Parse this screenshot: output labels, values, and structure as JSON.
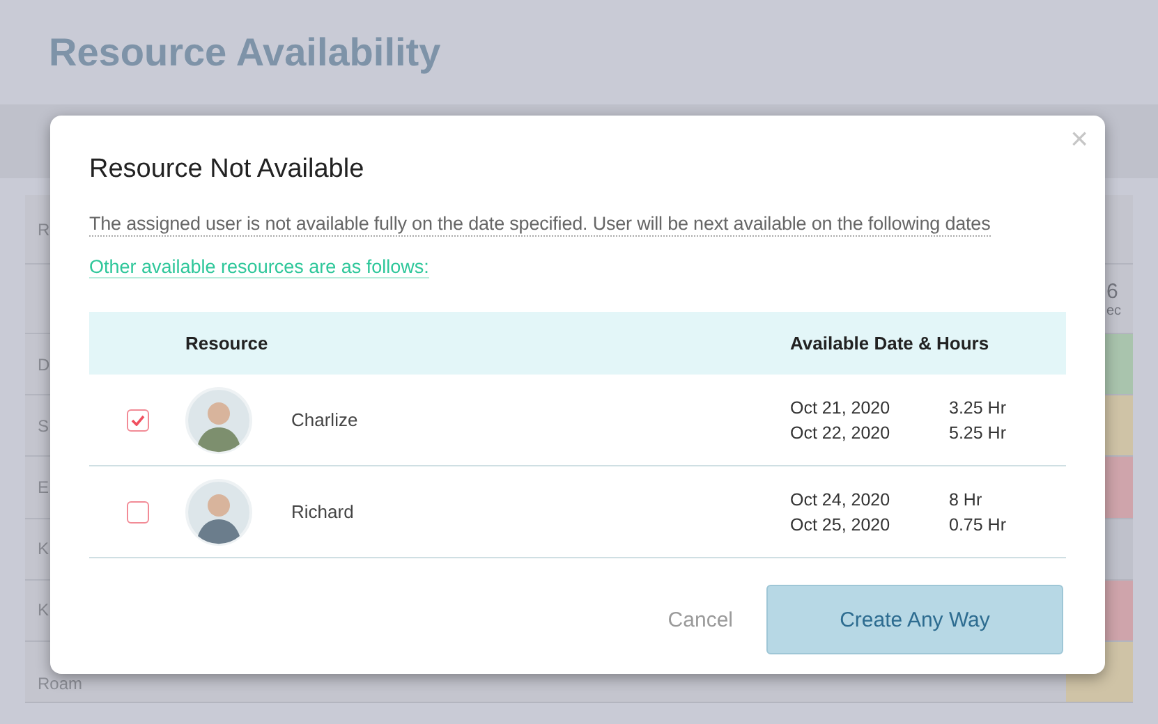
{
  "page": {
    "title": "Resource Availability"
  },
  "grid": {
    "header_label": "R",
    "header_date": "6",
    "header_month": "ec",
    "rows": [
      {
        "label": "D",
        "color": "#a9c4ad"
      },
      {
        "label": "S",
        "color": "#cfc3a6"
      },
      {
        "label": "E",
        "color": "#cfa4ab"
      },
      {
        "label": "K",
        "color": "#bfc1cb"
      },
      {
        "label": "K",
        "color": "#cfa4ab"
      },
      {
        "label": "Roam",
        "color": "#cfc3a6"
      }
    ]
  },
  "dialog": {
    "title": "Resource Not Available",
    "close": "×",
    "message": "The assigned user is not available fully on the date specified. User will be next available on the following dates",
    "link": "Other available resources are as follows:",
    "columns": [
      "Resource",
      "Available Date & Hours"
    ],
    "rows": [
      {
        "name": "Charlize",
        "checked": true,
        "slots": [
          {
            "date": "Oct 21, 2020",
            "hours": "3.25 Hr"
          },
          {
            "date": "Oct 22, 2020",
            "hours": "5.25 Hr"
          }
        ]
      },
      {
        "name": "Richard",
        "checked": false,
        "slots": [
          {
            "date": "Oct 24, 2020",
            "hours": "8 Hr"
          },
          {
            "date": "Oct 25, 2020",
            "hours": "0.75 Hr"
          }
        ]
      }
    ],
    "cancel": "Cancel",
    "confirm": "Create Any Way"
  }
}
